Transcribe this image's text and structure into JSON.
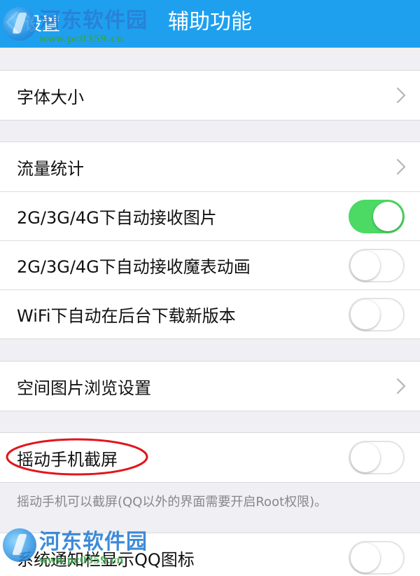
{
  "header": {
    "back_label": "设置",
    "title": "辅助功能",
    "background": "#1ea0ef"
  },
  "watermark": {
    "name": "河东软件园",
    "url": "www.pc0359.cn"
  },
  "settings": {
    "font_size": {
      "label": "字体大小",
      "control": "chevron"
    },
    "traffic_stats": {
      "label": "流量统计",
      "control": "chevron"
    },
    "auto_receive_images": {
      "label": "2G/3G/4G下自动接收图片",
      "enabled": true
    },
    "auto_receive_animations": {
      "label": "2G/3G/4G下自动接收魔表动画",
      "enabled": false
    },
    "wifi_auto_download": {
      "label": "WiFi下自动在后台下载新版本",
      "enabled": false
    },
    "qzone_image_settings": {
      "label": "空间图片浏览设置",
      "control": "chevron"
    },
    "shake_screenshot": {
      "label": "摇动手机截屏",
      "enabled": false,
      "note": "摇动手机可以截屏(QQ以外的界面需要开启Root权限)。"
    },
    "notification_qq_icon": {
      "label": "系统通知栏显示QQ图标",
      "enabled": false
    }
  },
  "colors": {
    "toggle_on": "#4cd964",
    "highlight": "#e0161b"
  }
}
